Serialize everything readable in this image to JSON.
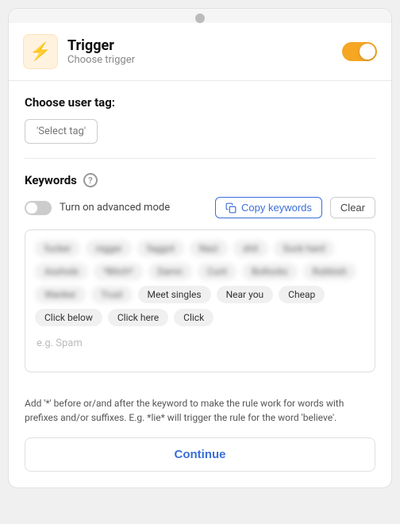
{
  "header": {
    "icon_label": "lightning",
    "title": "Trigger",
    "subtitle": "Choose trigger",
    "toggle_on": true
  },
  "user_tag": {
    "label": "Choose user tag:",
    "select_placeholder": "'Select tag'"
  },
  "keywords": {
    "label": "Keywords",
    "help": "?",
    "advanced_mode_label": "Turn on advanced mode",
    "copy_label": "Copy keywords",
    "clear_label": "Clear",
    "chips_blurred": [
      "fucker",
      "nigger",
      "faggot",
      "Nazi",
      "shit",
      "Suck hard",
      "Asshole",
      "*Bitch*",
      "Damn",
      "Cunt",
      "Bollocks",
      "Rubbish",
      "Wanker",
      "Trust"
    ],
    "chips_visible": [
      "Meet singles",
      "Near you",
      "Cheap",
      "Click below",
      "Click here",
      "Click"
    ],
    "placeholder": "e.g. Spam"
  },
  "note": "Add '*' before or/and after the keyword to make the rule work for words with prefixes and/or suffixes. E.g. *lie* will trigger the rule for the word 'believe'.",
  "continue_label": "Continue"
}
